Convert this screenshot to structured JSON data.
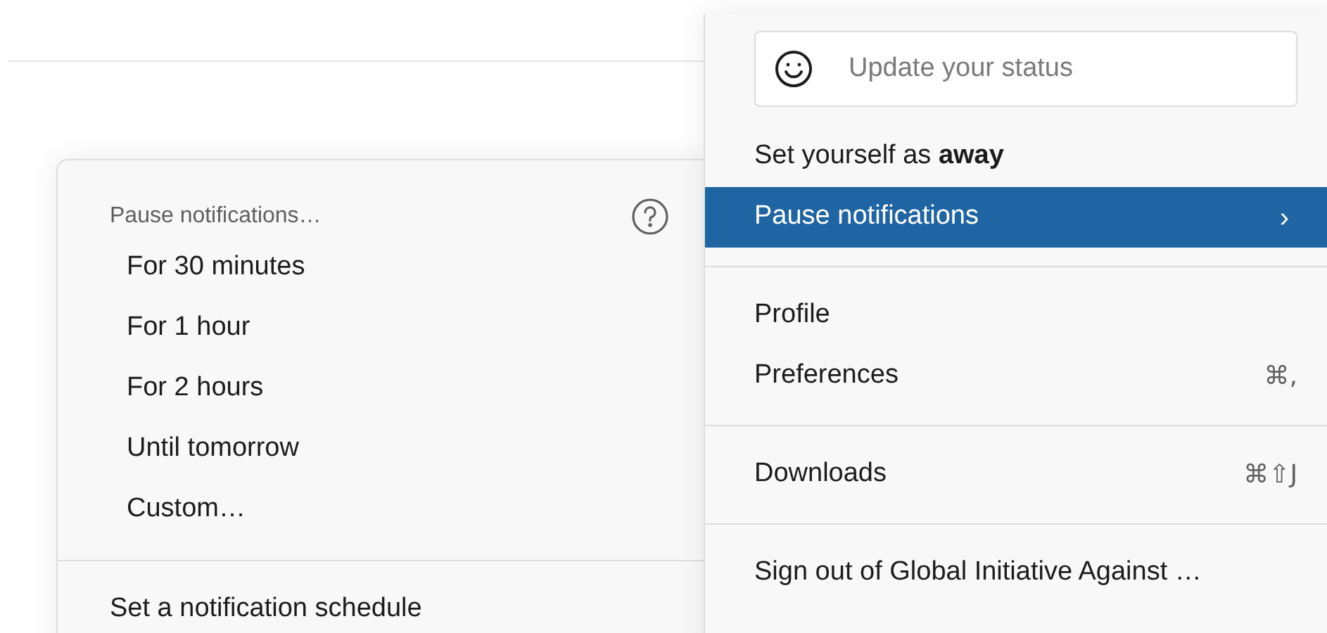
{
  "main_menu": {
    "status_field": {
      "placeholder": "Update your status"
    },
    "groups": [
      [
        {
          "label": "Set yourself as **away**",
          "selected": false
        },
        {
          "label": "Pause notifications",
          "selected": true,
          "submenu_arrow": "›"
        }
      ],
      [
        {
          "label": "Profile",
          "selected": false
        },
        {
          "label": "Preferences",
          "selected": false,
          "shortcut": "⌘,"
        }
      ],
      [
        {
          "label": "Downloads",
          "selected": false,
          "shortcut": "⌘⇧J"
        }
      ],
      [
        {
          "label": "Sign out of Global Initiative Against …",
          "selected": false
        }
      ]
    ]
  },
  "submenu": {
    "title": "Pause notifications…",
    "items": [
      {
        "label": "For 30 minutes"
      },
      {
        "label": "For 1 hour"
      },
      {
        "label": "For 2 hours"
      },
      {
        "label": "Until tomorrow"
      },
      {
        "label": "Custom…"
      }
    ],
    "footer_items": [
      {
        "label": "Set a notification schedule"
      }
    ]
  }
}
